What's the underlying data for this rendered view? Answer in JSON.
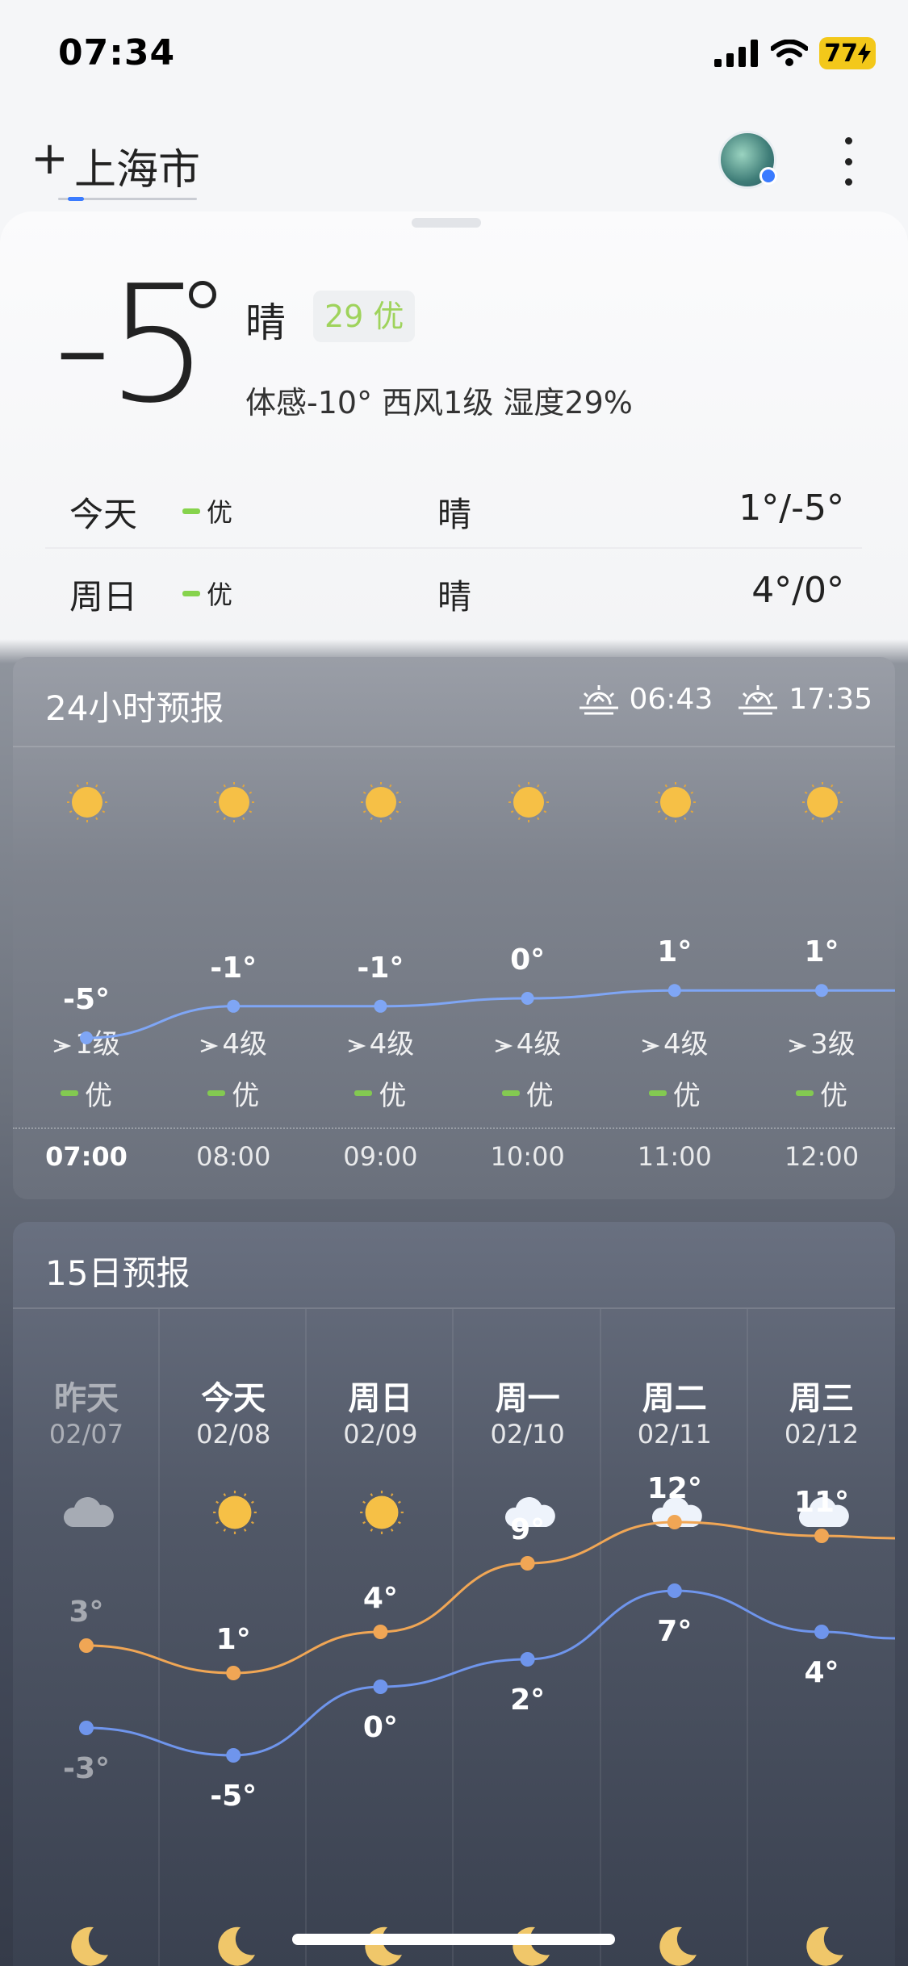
{
  "status_bar": {
    "time": "07:34",
    "battery": "77"
  },
  "header": {
    "add_symbol": "+",
    "city": "上海市"
  },
  "current": {
    "temp": "-5",
    "condition": "晴",
    "aqi_badge": "29 优",
    "details": "体感-10° 西风1级 湿度29%"
  },
  "days_summary": [
    {
      "label": "今天",
      "aqi": "优",
      "condition": "晴",
      "range": "1°/-5°"
    },
    {
      "label": "周日",
      "aqi": "优",
      "condition": "晴",
      "range": "4°/0°"
    }
  ],
  "hourly": {
    "title": "24小时预报",
    "sunrise": "06:43",
    "sunset": "17:35",
    "hours": [
      {
        "time": "07:00",
        "temp": "-5°",
        "wind": "1级",
        "aqi": "优",
        "icon": "sun-icon",
        "wind_icon": "wind-arrow-icon"
      },
      {
        "time": "08:00",
        "temp": "-1°",
        "wind": "4级",
        "aqi": "优",
        "icon": "sun-icon",
        "wind_icon": "wind-arrow-icon"
      },
      {
        "time": "09:00",
        "temp": "-1°",
        "wind": "4级",
        "aqi": "优",
        "icon": "sun-icon",
        "wind_icon": "wind-arrow-icon"
      },
      {
        "time": "10:00",
        "temp": "0°",
        "wind": "4级",
        "aqi": "优",
        "icon": "sun-icon",
        "wind_icon": "wind-arrow-icon"
      },
      {
        "time": "11:00",
        "temp": "1°",
        "wind": "4级",
        "aqi": "优",
        "icon": "sun-icon",
        "wind_icon": "wind-arrow-icon"
      },
      {
        "time": "12:00",
        "temp": "1°",
        "wind": "3级",
        "aqi": "优",
        "icon": "sun-icon",
        "wind_icon": "wind-arrow-icon"
      }
    ]
  },
  "daily": {
    "title": "15日预报",
    "days": [
      {
        "name": "昨天",
        "date": "02/07",
        "high": "3°",
        "low": "-3°",
        "icon": "cloud-icon"
      },
      {
        "name": "今天",
        "date": "02/08",
        "high": "1°",
        "low": "-5°",
        "icon": "sun-icon"
      },
      {
        "name": "周日",
        "date": "02/09",
        "high": "4°",
        "low": "0°",
        "icon": "sun-icon"
      },
      {
        "name": "周一",
        "date": "02/10",
        "high": "9°",
        "low": "2°",
        "icon": "cloud-icon"
      },
      {
        "name": "周二",
        "date": "02/11",
        "high": "12°",
        "low": "7°",
        "icon": "cloud-icon"
      },
      {
        "name": "周三",
        "date": "02/12",
        "high": "11°",
        "low": "4°",
        "icon": "rain-cloud-icon"
      }
    ]
  },
  "colors": {
    "high_line": "#f0a655",
    "low_line": "#6f95ec",
    "hourly_line": "#7fa6f5",
    "aqi_good": "#86d34c",
    "sun": "#f6c046"
  }
}
